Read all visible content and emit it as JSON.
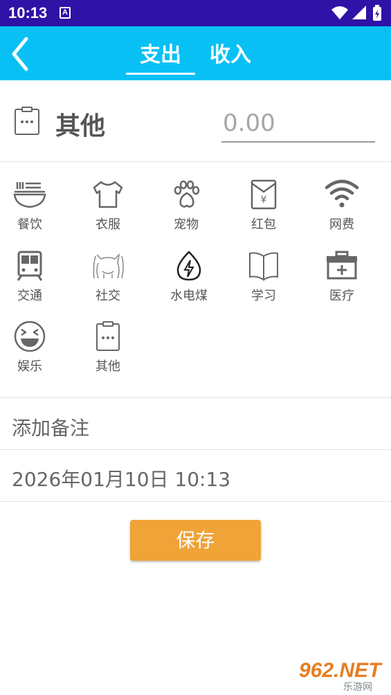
{
  "status_bar": {
    "time": "10:13",
    "notification_letter": "A"
  },
  "header": {
    "tabs": [
      {
        "label": "支出",
        "selected": true
      },
      {
        "label": "收入",
        "selected": false
      }
    ]
  },
  "entry": {
    "selected_category": "其他",
    "amount_placeholder": "0.00"
  },
  "categories": [
    {
      "label": "餐饮",
      "icon": "bowl-icon"
    },
    {
      "label": "衣服",
      "icon": "tshirt-icon"
    },
    {
      "label": "宠物",
      "icon": "paw-icon"
    },
    {
      "label": "红包",
      "icon": "red-envelope-icon"
    },
    {
      "label": "网费",
      "icon": "wifi-icon"
    },
    {
      "label": "交通",
      "icon": "train-icon"
    },
    {
      "label": "社交",
      "icon": "people-icon"
    },
    {
      "label": "水电煤",
      "icon": "water-electric-icon"
    },
    {
      "label": "学习",
      "icon": "book-icon"
    },
    {
      "label": "医疗",
      "icon": "medical-kit-icon"
    },
    {
      "label": "娱乐",
      "icon": "laughing-face-icon"
    },
    {
      "label": "其他",
      "icon": "clipboard-icon"
    }
  ],
  "note": {
    "placeholder": "添加备注"
  },
  "datetime": "2026年01月10日 10:13",
  "save_label": "保存",
  "watermark": {
    "brand": "962.NET",
    "sub": "乐游网"
  }
}
